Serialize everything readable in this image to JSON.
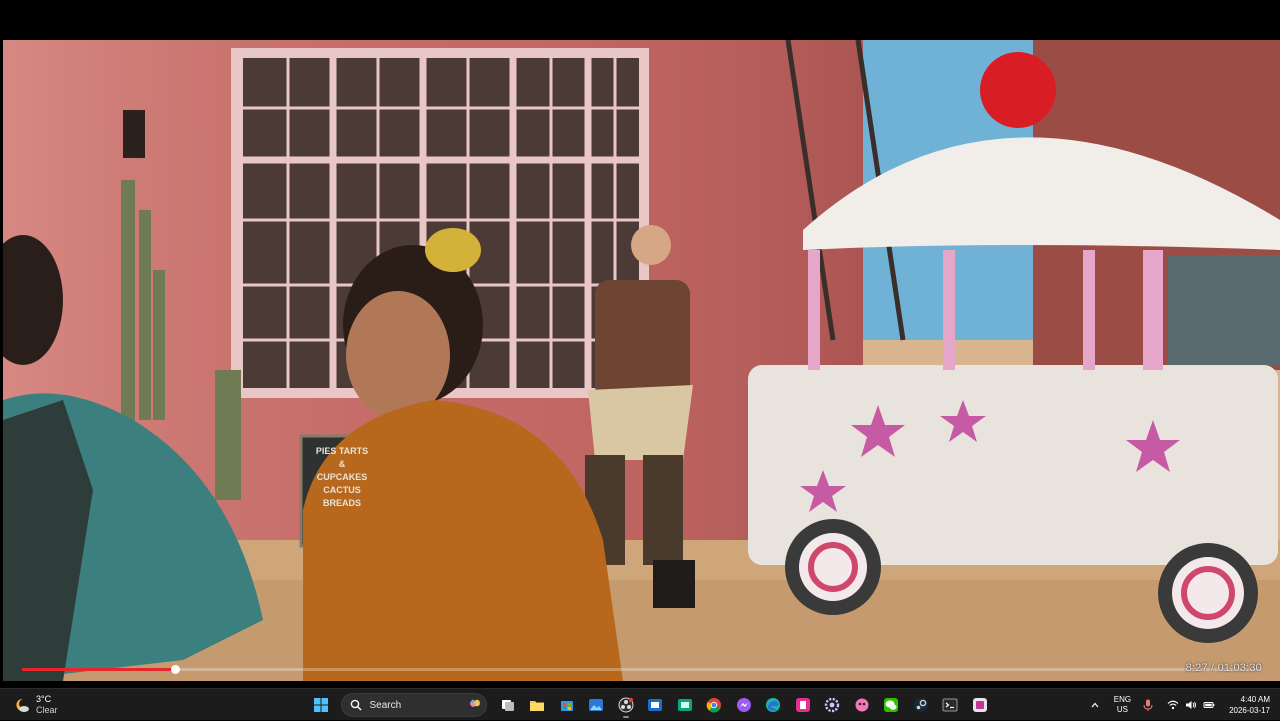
{
  "player": {
    "scene": "pink adobe bakery with cupcake-shaped cart",
    "sign_text": [
      "PIES TARTS",
      "&",
      "CUPCAKES",
      "CACTUS",
      "BREADS"
    ],
    "progress_fraction": 0.123,
    "progress_color": "#e8262a",
    "timecode": "8:27 / 01:03:30"
  },
  "taskbar": {
    "weather": {
      "temp": "3°C",
      "condition": "Clear",
      "icon": "moon-cloud-icon"
    },
    "search": {
      "label": "Search"
    },
    "pinned": [
      {
        "name": "windows-start-icon"
      },
      {
        "name": "task-view-icon"
      },
      {
        "name": "file-explorer-icon"
      },
      {
        "name": "microsoft-store-icon"
      },
      {
        "name": "photos-icon"
      },
      {
        "name": "obs-icon",
        "active": true
      },
      {
        "name": "snipping-tool-icon"
      },
      {
        "name": "winget-icon"
      },
      {
        "name": "chrome-icon"
      },
      {
        "name": "messenger-icon"
      },
      {
        "name": "edge-icon"
      },
      {
        "name": "pink-app-icon"
      },
      {
        "name": "settings-icon"
      },
      {
        "name": "pink-game-icon"
      },
      {
        "name": "wechat-icon"
      },
      {
        "name": "steam-icon"
      },
      {
        "name": "terminal-icon"
      },
      {
        "name": "app-store-icon"
      }
    ],
    "tray": {
      "lang_top": "ENG",
      "lang_bottom": "US",
      "time": "4:40 AM",
      "date": "2026-03-17"
    }
  }
}
